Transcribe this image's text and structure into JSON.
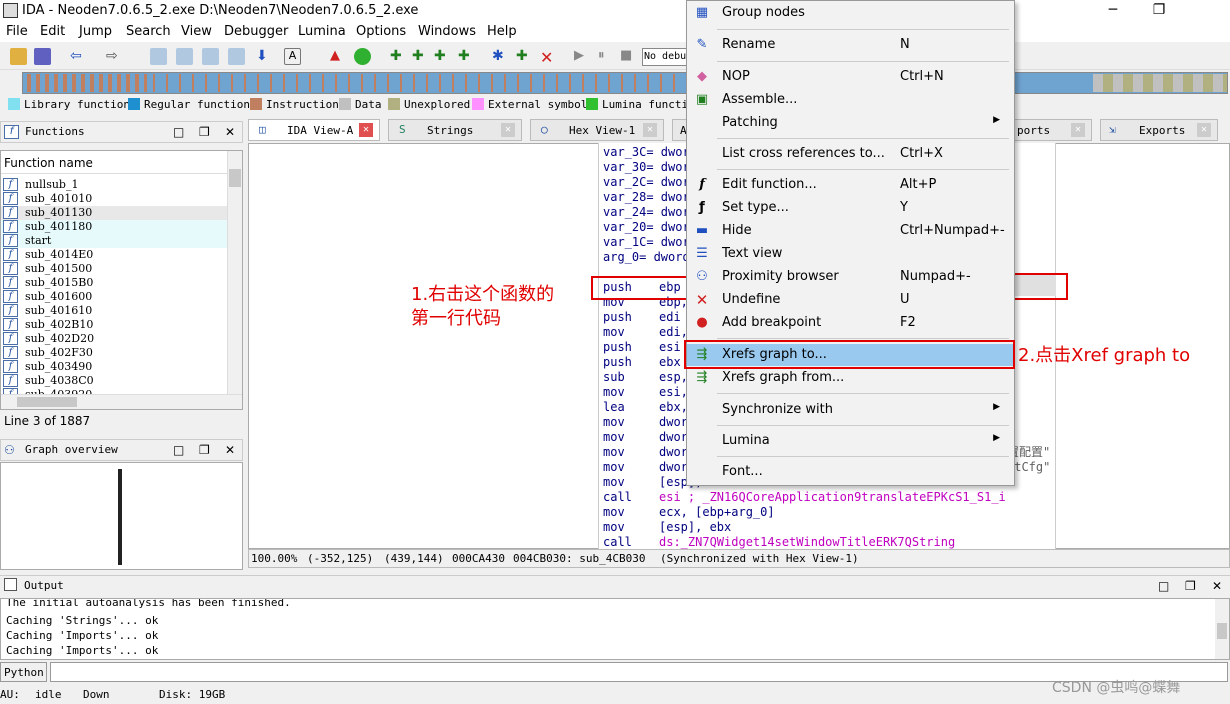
{
  "window": {
    "title": "IDA - Neoden7.0.6.5_2.exe D:\\Neoden7\\Neoden7.0.6.5_2.exe",
    "minimize": "─",
    "restore": "❐"
  },
  "menu": [
    "File",
    "Edit",
    "Jump",
    "Search",
    "View",
    "Debugger",
    "Lumina",
    "Options",
    "Windows",
    "Help"
  ],
  "toolbar": {
    "debugger_select": "No debu"
  },
  "legend": [
    {
      "label": "Library function",
      "color": "#80e0f0"
    },
    {
      "label": "Regular function",
      "color": "#1e90d0"
    },
    {
      "label": "Instruction",
      "color": "#c08060"
    },
    {
      "label": "Data",
      "color": "#c0c0c0"
    },
    {
      "label": "Unexplored",
      "color": "#b0b080"
    },
    {
      "label": "External symbol",
      "color": "#ff90ff"
    },
    {
      "label": "Lumina function",
      "color": "#30c030"
    }
  ],
  "functions_panel": {
    "title": "Functions",
    "column": "Function name",
    "items": [
      "nullsub_1",
      "sub_401010",
      "sub_401130",
      "sub_401180",
      "start",
      "sub_4014E0",
      "sub_401500",
      "sub_4015B0",
      "sub_401600",
      "sub_401610",
      "sub_402B10",
      "sub_402D20",
      "sub_402F30",
      "sub_403490",
      "sub_4038C0",
      "sub_403920"
    ],
    "line_info": "Line 3 of 1887"
  },
  "graph_overview": {
    "title": "Graph overview"
  },
  "tabs": [
    {
      "label": "IDA View-A"
    },
    {
      "label": "Strings"
    },
    {
      "label": "Hex View-1"
    },
    {
      "label": "A"
    },
    {
      "label": "ports"
    },
    {
      "label": "Exports"
    }
  ],
  "code": {
    "vars": [
      "var_3C= dwor",
      "var_30= dwor",
      "var_2C= dwor",
      "var_28= dwor",
      "var_24= dwor",
      "var_20= dwor",
      "var_1C= dwor",
      "arg_0= dword"
    ],
    "lines": [
      {
        "op": "push",
        "arg": "ebp"
      },
      {
        "op": "mov",
        "arg": "ebp,"
      },
      {
        "op": "push",
        "arg": "edi"
      },
      {
        "op": "mov",
        "arg": "edi,"
      },
      {
        "op": "push",
        "arg": "esi"
      },
      {
        "op": "push",
        "arg": "ebx"
      },
      {
        "op": "sub",
        "arg": "esp,"
      },
      {
        "op": "mov",
        "arg": "esi,"
      },
      {
        "op": "lea",
        "arg": "ebx,"
      },
      {
        "op": "mov",
        "arg": "dwor"
      },
      {
        "op": "mov",
        "arg": "dwor"
      },
      {
        "op": "mov",
        "arg": "dwor"
      },
      {
        "op": "mov",
        "arg": "dwor"
      },
      {
        "op": "mov",
        "arg": "[esp], ebx"
      },
      {
        "op": "call",
        "arg": "esi ; _ZN16QCoreApplication9translateEPKcS1_S1_i"
      },
      {
        "op": "mov",
        "arg": "ecx, [ebp+arg_0]"
      },
      {
        "op": "mov",
        "arg": "[esp], ebx"
      },
      {
        "op": "call",
        "arg": "ds:_ZN7QWidget14setWindowTitleERK7QString"
      }
    ],
    "right_fragments": [
      "置配置\"",
      "stCfg\""
    ]
  },
  "status": {
    "zoom": "100.00%",
    "coords": "(-352,125)",
    "pos": "(439,144)",
    "offset": "000CA430",
    "addr": "004CB030: sub_4CB030",
    "sync": "(Synchronized with Hex View-1)"
  },
  "output": {
    "title": "Output",
    "lines": [
      "The initial autoanalysis has been finished.",
      "Caching 'Strings'... ok",
      "Caching 'Imports'... ok",
      "Caching 'Imports'... ok"
    ],
    "python_label": "Python"
  },
  "bottom_status": {
    "au": "AU:",
    "state": "idle",
    "dir": "Down",
    "disk": "Disk: 19GB"
  },
  "context_menu": {
    "items": [
      {
        "label": "Group nodes",
        "shortcut": "",
        "icon": "group-nodes-icon",
        "glyph": "▦"
      },
      {
        "label": "Rename",
        "shortcut": "N",
        "icon": "rename-icon",
        "glyph": "✎"
      },
      {
        "label": "NOP",
        "shortcut": "Ctrl+N",
        "icon": "eraser-icon",
        "glyph": "◆"
      },
      {
        "label": "Assemble...",
        "shortcut": "",
        "icon": "chip-icon",
        "glyph": "▣"
      },
      {
        "label": "Patching",
        "shortcut": "",
        "icon": "",
        "glyph": "",
        "submenu": true
      },
      {
        "label": "List cross references to...",
        "shortcut": "Ctrl+X",
        "icon": "",
        "glyph": ""
      },
      {
        "label": "Edit function...",
        "shortcut": "Alt+P",
        "icon": "function-icon",
        "glyph": "f"
      },
      {
        "label": "Set type...",
        "shortcut": "Y",
        "icon": "set-type-icon",
        "glyph": "ƒ"
      },
      {
        "label": "Hide",
        "shortcut": "Ctrl+Numpad+-",
        "icon": "hide-icon",
        "glyph": "▬"
      },
      {
        "label": "Text view",
        "shortcut": "",
        "icon": "text-view-icon",
        "glyph": "☰"
      },
      {
        "label": "Proximity browser",
        "shortcut": "Numpad+-",
        "icon": "proximity-icon",
        "glyph": "⚇"
      },
      {
        "label": "Undefine",
        "shortcut": "U",
        "icon": "undefine-icon",
        "glyph": "✕"
      },
      {
        "label": "Add breakpoint",
        "shortcut": "F2",
        "icon": "breakpoint-icon",
        "glyph": "●"
      },
      {
        "label": "Xrefs graph to...",
        "shortcut": "",
        "icon": "xrefs-to-icon",
        "glyph": "⇶",
        "highlight": true
      },
      {
        "label": "Xrefs graph from...",
        "shortcut": "",
        "icon": "xrefs-from-icon",
        "glyph": "⇶"
      },
      {
        "label": "Synchronize with",
        "shortcut": "",
        "icon": "",
        "glyph": "",
        "submenu": true
      },
      {
        "label": "Lumina",
        "shortcut": "",
        "icon": "",
        "glyph": "",
        "submenu": true
      },
      {
        "label": "Font...",
        "shortcut": "",
        "icon": "",
        "glyph": ""
      }
    ]
  },
  "annotations": {
    "step1_line1": "1.右击这个函数的",
    "step1_line2": "第一行代码",
    "step2": "2.点击Xref graph to",
    "watermark": "CSDN @虫鸣@蝶舞"
  },
  "colors": {
    "highlight": "#99c9ef",
    "annotation": "#e00000",
    "navband": "#6fa3d0"
  }
}
